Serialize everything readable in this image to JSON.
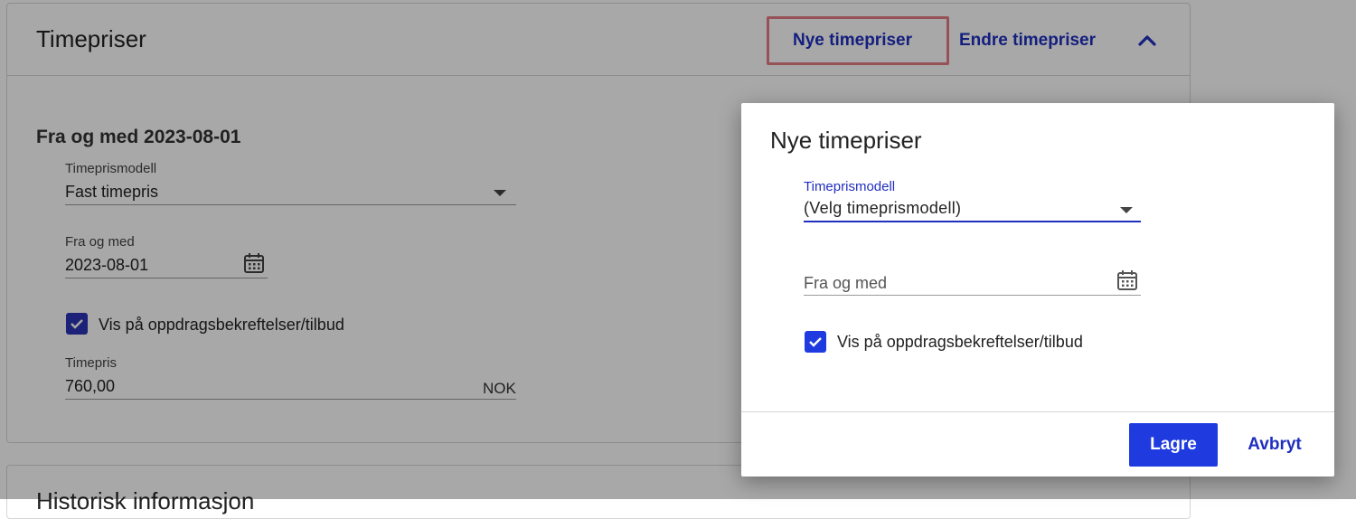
{
  "card": {
    "title": "Timepriser",
    "header_links": {
      "new": "Nye timepriser",
      "edit": "Endre timepriser"
    },
    "section_title": "Fra og med 2023-08-01",
    "fields": {
      "model_label": "Timeprismodell",
      "model_value": "Fast timepris",
      "date_label": "Fra og med",
      "date_value": "2023-08-01",
      "checkbox_label": "Vis på oppdragsbekreftelser/tilbud",
      "price_label": "Timepris",
      "price_value": "760,00",
      "price_unit": "NOK"
    }
  },
  "card2": {
    "title": "Historisk informasjon"
  },
  "dialog": {
    "title": "Nye timepriser",
    "model_label": "Timeprismodell",
    "model_value": "(Velg timeprismodell)",
    "date_placeholder": "Fra og med",
    "checkbox_label": "Vis på oppdragsbekreftelser/tilbud",
    "save_label": "Lagre",
    "cancel_label": "Avbryt"
  },
  "colors": {
    "accent": "#1f3be0",
    "link": "#1f2fbf",
    "highlight": "#e57d86"
  }
}
